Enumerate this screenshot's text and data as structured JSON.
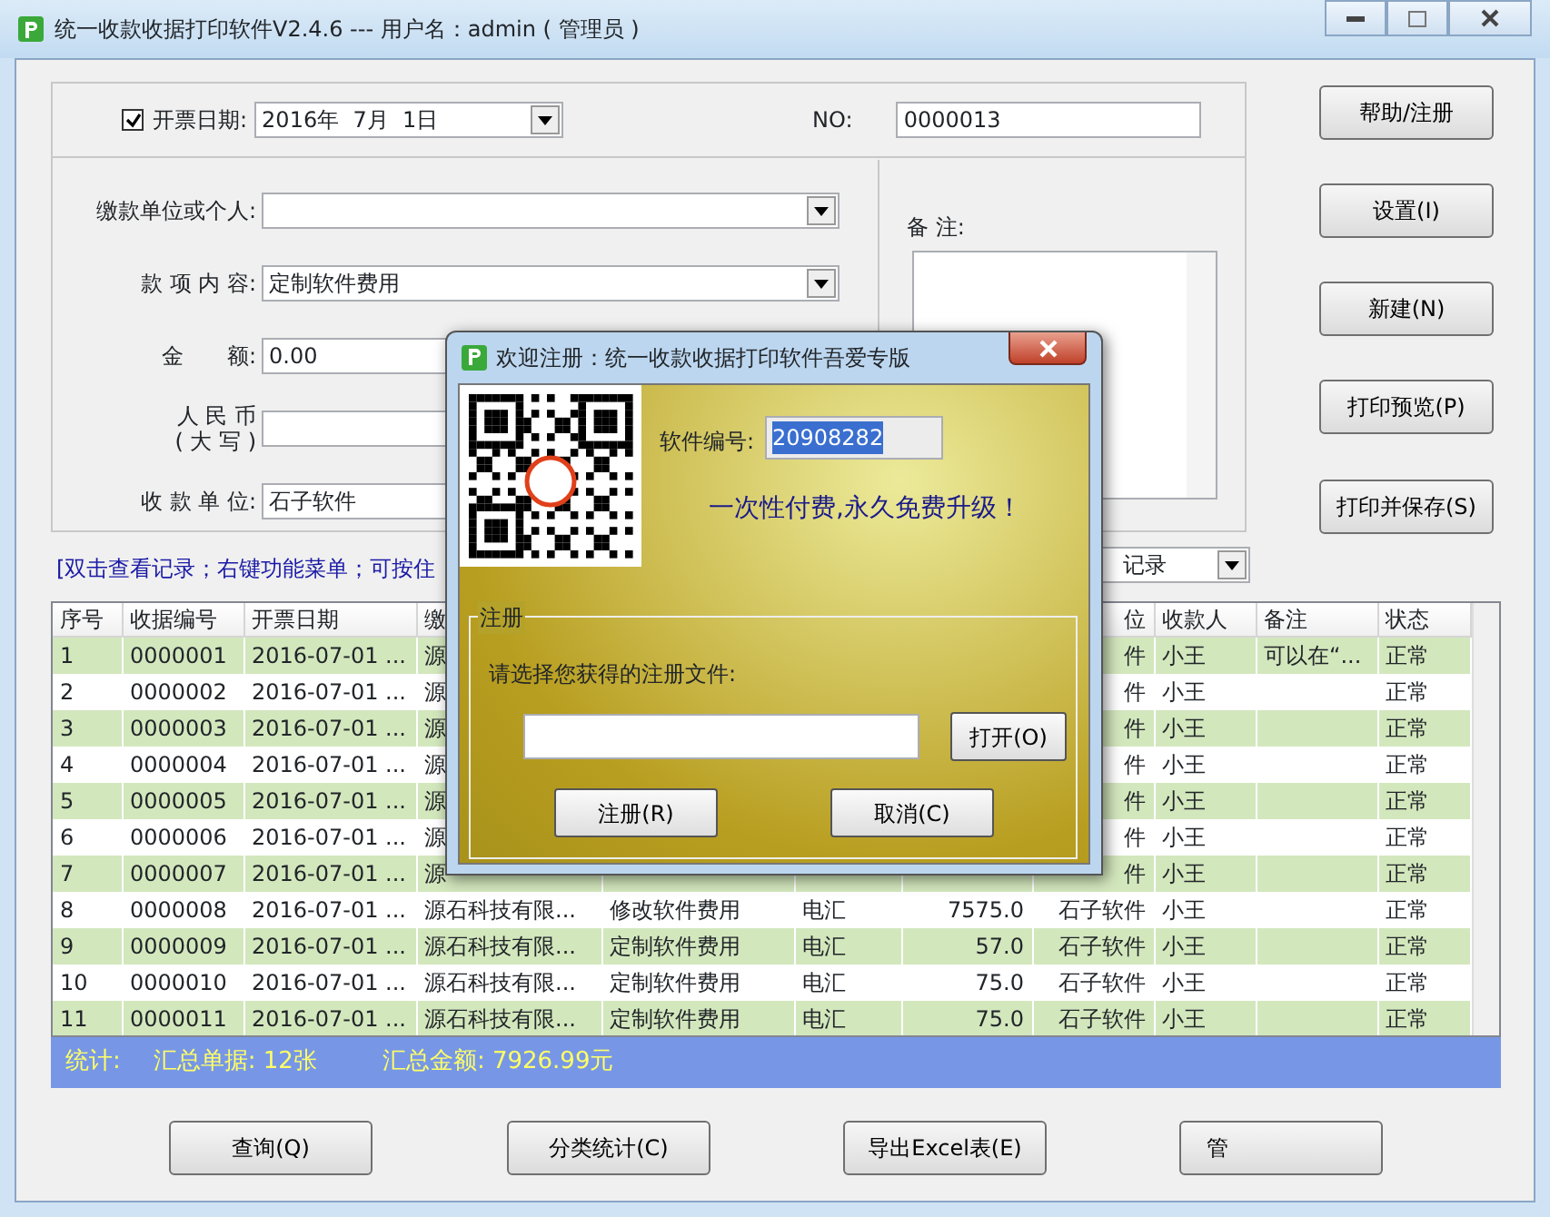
{
  "window": {
    "title": "统一收款收据打印软件V2.4.6 --- 用户名：admin ( 管理员 )"
  },
  "form": {
    "date_enabled": true,
    "date_label": "开票日期:",
    "date": "2016年  7月  1日",
    "no_label": "NO:",
    "no": "0000013",
    "fields": [
      {
        "label": "缴款单位或个人:",
        "kind": "combo"
      },
      {
        "label": "款 项 内 容:",
        "value": "定制软件费用",
        "kind": "combo"
      },
      {
        "label": "金　　额:",
        "value": "0.00",
        "kind": "text"
      },
      {
        "label": "人 民 币\n( 大 写 )",
        "kind": "text"
      },
      {
        "label": "收 款 单 位:",
        "value": "石子软件",
        "kind": "text"
      }
    ],
    "remark_label": "备 注:"
  },
  "side_buttons": [
    "帮助/注册",
    "设置(I)",
    "新建(N)",
    "打印预览(P)",
    "打印并保存(S)"
  ],
  "hint": "[双击查看记录；右键功能菜单；可按住",
  "filter": "记录",
  "table": {
    "columns": [
      "序号",
      "收据编号",
      "开票日期",
      "缴",
      "",
      "",
      "",
      "位",
      "收款人",
      "备注",
      "状态"
    ],
    "rows": [
      [
        "1",
        "0000001",
        "2016-07-01 ...",
        "源",
        "",
        "",
        "",
        "件",
        "小王",
        "可以在“...",
        "正常"
      ],
      [
        "2",
        "0000002",
        "2016-07-01 ...",
        "源",
        "",
        "",
        "",
        "件",
        "小王",
        "",
        "正常"
      ],
      [
        "3",
        "0000003",
        "2016-07-01 ...",
        "源",
        "",
        "",
        "",
        "件",
        "小王",
        "",
        "正常"
      ],
      [
        "4",
        "0000004",
        "2016-07-01 ...",
        "源",
        "",
        "",
        "",
        "件",
        "小王",
        "",
        "正常"
      ],
      [
        "5",
        "0000005",
        "2016-07-01 ...",
        "源",
        "",
        "",
        "",
        "件",
        "小王",
        "",
        "正常"
      ],
      [
        "6",
        "0000006",
        "2016-07-01 ...",
        "源",
        "",
        "",
        "",
        "件",
        "小王",
        "",
        "正常"
      ],
      [
        "7",
        "0000007",
        "2016-07-01 ...",
        "源",
        "",
        "",
        "",
        "件",
        "小王",
        "",
        "正常"
      ],
      [
        "8",
        "0000008",
        "2016-07-01 ...",
        "源石科技有限...",
        "修改软件费用",
        "电汇",
        "7575.0",
        "石子软件",
        "小王",
        "",
        "正常"
      ],
      [
        "9",
        "0000009",
        "2016-07-01 ...",
        "源石科技有限...",
        "定制软件费用",
        "电汇",
        "57.0",
        "石子软件",
        "小王",
        "",
        "正常"
      ],
      [
        "10",
        "0000010",
        "2016-07-01 ...",
        "源石科技有限...",
        "定制软件费用",
        "电汇",
        "75.0",
        "石子软件",
        "小王",
        "",
        "正常"
      ],
      [
        "11",
        "0000011",
        "2016-07-01 ...",
        "源石科技有限...",
        "定制软件费用",
        "电汇",
        "75.0",
        "石子软件",
        "小王",
        "",
        "正常"
      ]
    ]
  },
  "summary": {
    "label": "统计:",
    "count": "汇总单据: 12张",
    "total": "汇总金额: 7926.99元"
  },
  "bottom_buttons": [
    "查询(Q)",
    "分类统计(C)",
    "导出Excel表(E)",
    "管"
  ],
  "dialog": {
    "title": "欢迎注册：统一收款收据打印软件吾爱专版",
    "serial_label": "软件编号:",
    "serial": "20908282",
    "slogan": "一次性付费,永久免费升级！",
    "group": "注册",
    "prompt": "请选择您获得的注册文件:",
    "open_button": "打开(O)",
    "buttons": [
      "注册(R)",
      "取消(C)"
    ]
  }
}
